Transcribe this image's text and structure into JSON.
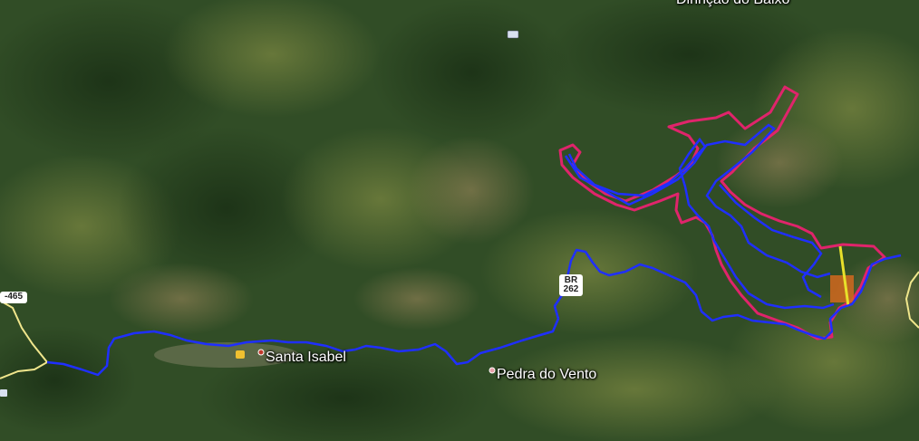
{
  "map": {
    "places": [
      {
        "name": "Santa Isabel"
      },
      {
        "name": "Pedra do Vento"
      },
      {
        "name": "Dirinção do Baixo"
      }
    ],
    "road_shield": {
      "line1": "BR",
      "line2": "262"
    },
    "road_left": "-465"
  },
  "colors": {
    "route": "#1f2fff",
    "polygon": "#e0246b",
    "highlight": "#e8e02a",
    "patch": "#d2691e",
    "road": "#f0e68c"
  }
}
